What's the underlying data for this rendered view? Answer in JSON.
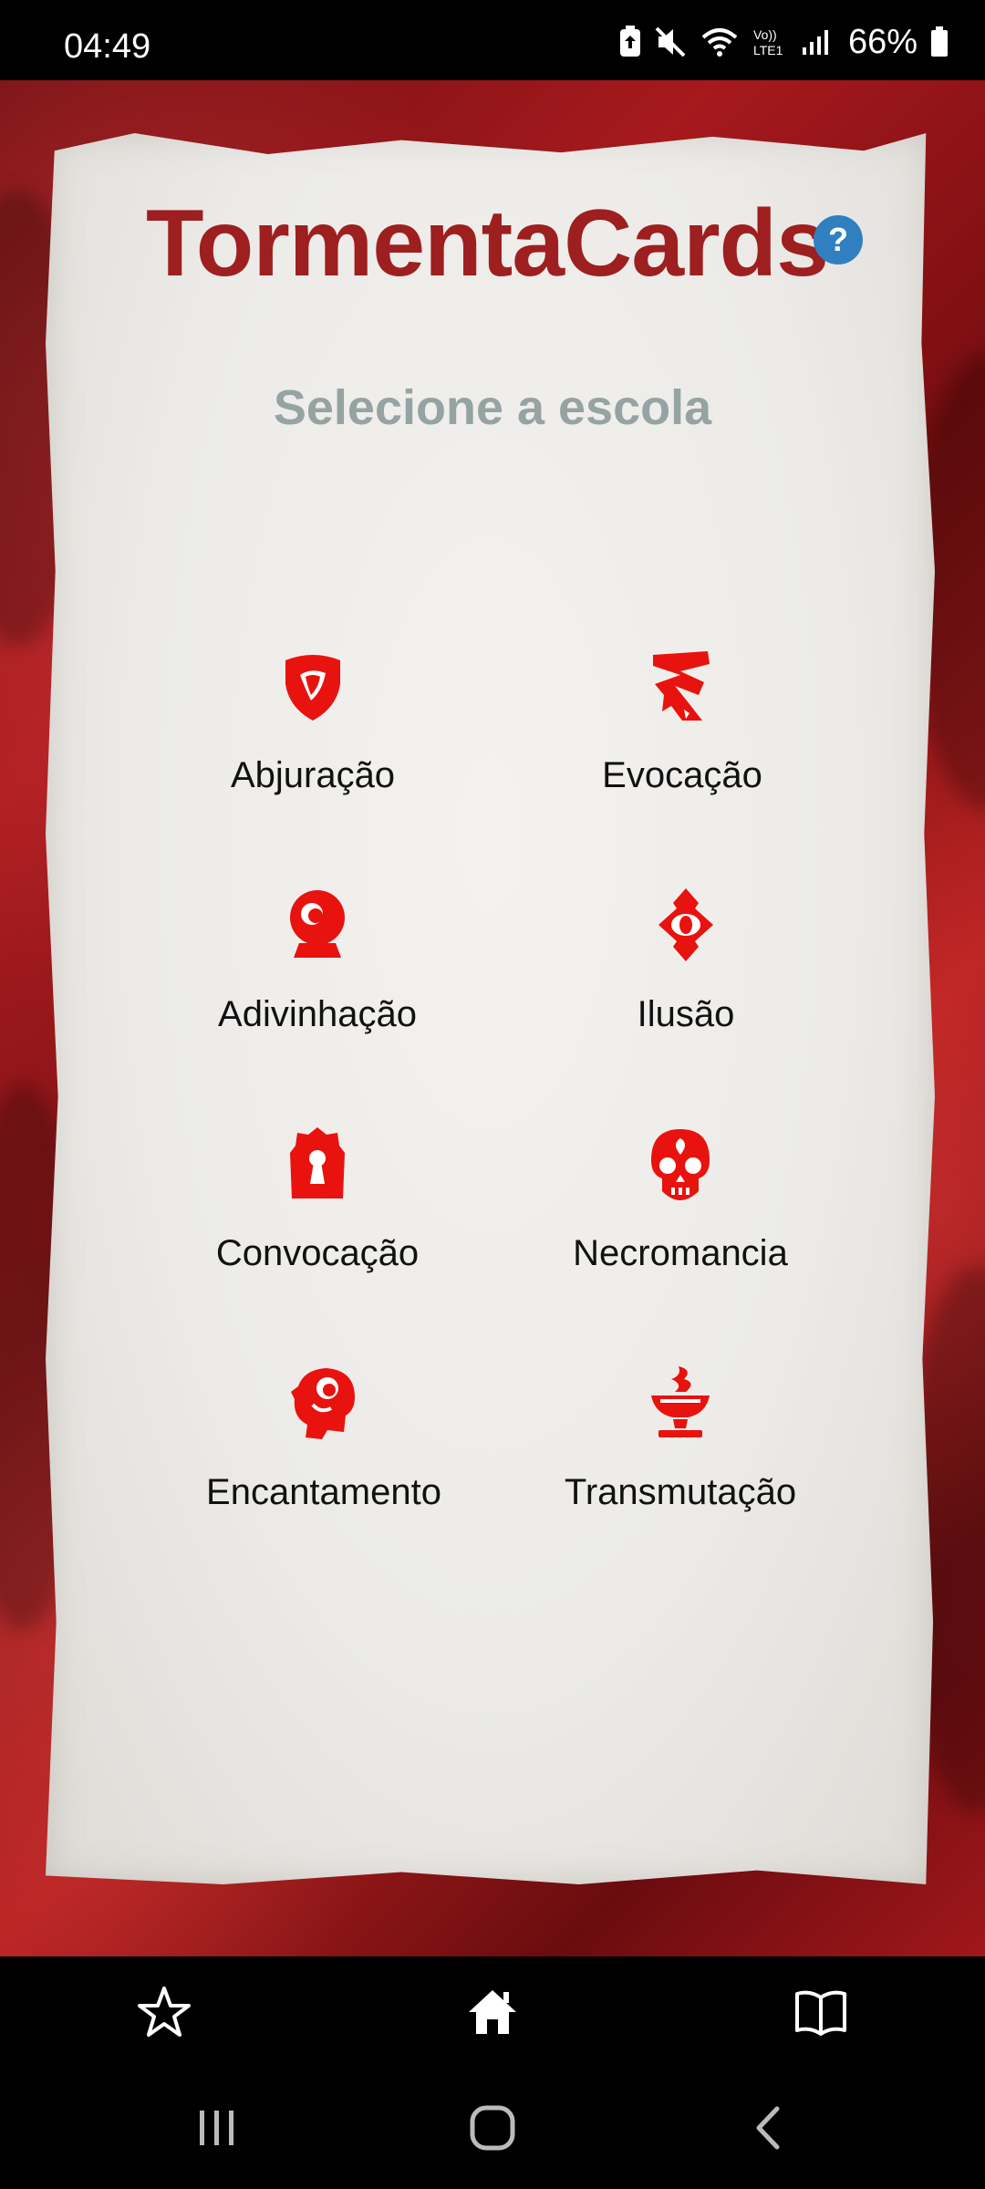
{
  "status_bar": {
    "time": "04:49",
    "battery_percent": "66%",
    "icons": [
      "battery-saver-icon",
      "mute-icon",
      "wifi-icon",
      "volte-lte-icon",
      "signal-icon",
      "battery-icon"
    ]
  },
  "app": {
    "title": "TormentaCards",
    "help_label": "?",
    "subtitle": "Selecione a escola"
  },
  "schools": [
    {
      "label": "Abjuração",
      "icon": "shield-icon"
    },
    {
      "label": "Evocação",
      "icon": "lightning-icon"
    },
    {
      "label": "Adivinhação",
      "icon": "crystal-ball-icon"
    },
    {
      "label": "Ilusão",
      "icon": "eye-diamond-icon"
    },
    {
      "label": "Convocação",
      "icon": "keyhole-icon"
    },
    {
      "label": "Necromancia",
      "icon": "skull-icon"
    },
    {
      "label": "Encantamento",
      "icon": "head-profile-icon"
    },
    {
      "label": "Transmutação",
      "icon": "brazier-icon"
    }
  ],
  "bottom_nav": {
    "items": [
      "favorites-star-icon",
      "home-icon",
      "book-icon"
    ]
  },
  "system_nav": {
    "items": [
      "recents-icon",
      "home-circle-icon",
      "back-icon"
    ]
  },
  "colors": {
    "title": "#9e1f1f",
    "icon_red": "#e8120f",
    "subtitle": "#95a3a3",
    "help": "#2f7fc1"
  }
}
